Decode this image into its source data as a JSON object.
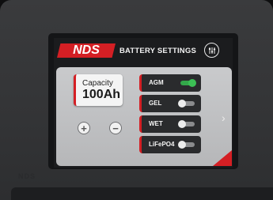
{
  "header": {
    "logo_text": "NDS",
    "title": "BATTERY SETTINGS",
    "settings_icon": "sliders-icon"
  },
  "capacity": {
    "label": "Capacity",
    "value": "100Ah",
    "increase_symbol": "+",
    "decrease_symbol": "−"
  },
  "battery_types": [
    {
      "label": "AGM",
      "active": true
    },
    {
      "label": "GEL",
      "active": false
    },
    {
      "label": "WET",
      "active": false
    },
    {
      "label": "LiFePO4",
      "active": false
    }
  ],
  "nav": {
    "next_symbol": "›"
  },
  "device": {
    "brand_mark": "NDS"
  },
  "colors": {
    "accent": "#d41f24",
    "toggle_on": "#3cc055",
    "panel": "#c0c1c3"
  }
}
